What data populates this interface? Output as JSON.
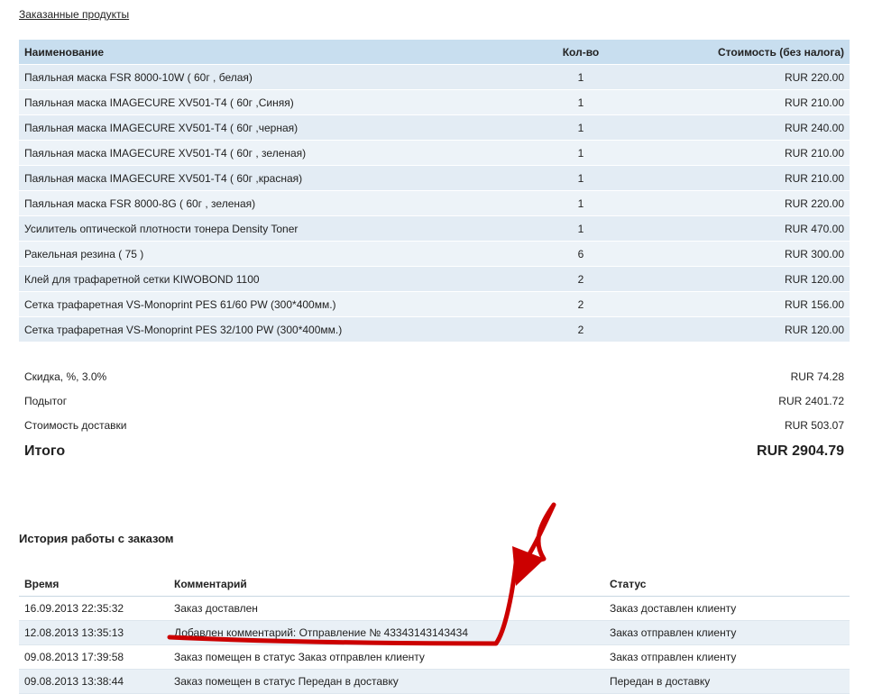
{
  "main": {
    "ordered_title": "Заказанные продукты",
    "columns": {
      "name": "Наименование",
      "qty": "Кол-во",
      "price": "Стоимость (без налога)"
    },
    "products": [
      {
        "name": "Паяльная маска FSR 8000-10W ( 60г , белая)",
        "qty": "1",
        "price": "RUR 220.00"
      },
      {
        "name": "Паяльная маска IMAGECURE XV501-T4 ( 60г ,Синяя)",
        "qty": "1",
        "price": "RUR 210.00"
      },
      {
        "name": "Паяльная маска IMAGECURE XV501-T4 ( 60г ,черная)",
        "qty": "1",
        "price": "RUR 240.00"
      },
      {
        "name": "Паяльная маска IMAGECURE XV501-T4 ( 60г , зеленая)",
        "qty": "1",
        "price": "RUR 210.00"
      },
      {
        "name": "Паяльная маска IMAGECURE XV501-T4 ( 60г ,красная)",
        "qty": "1",
        "price": "RUR 210.00"
      },
      {
        "name": "Паяльная маска FSR 8000-8G ( 60г , зеленая)",
        "qty": "1",
        "price": "RUR 220.00"
      },
      {
        "name": "Усилитель оптической плотности тонера Density Toner",
        "qty": "1",
        "price": "RUR 470.00"
      },
      {
        "name": "Ракельная резина ( 75 )",
        "qty": "6",
        "price": "RUR 300.00"
      },
      {
        "name": "Клей для трафаретной сетки KIWOBOND 1100",
        "qty": "2",
        "price": "RUR 120.00"
      },
      {
        "name": "Сетка трафаретная VS-Monoprint PES 61/60 PW (300*400мм.)",
        "qty": "2",
        "price": "RUR 156.00"
      },
      {
        "name": "Сетка трафаретная VS-Monoprint PES 32/100 PW (300*400мм.)",
        "qty": "2",
        "price": "RUR 120.00"
      }
    ],
    "totals": {
      "discount_label": "Скидка, %, 3.0%",
      "discount_value": "RUR 74.28",
      "subtotal_label": "Подытог",
      "subtotal_value": "RUR 2401.72",
      "shipping_label": "Стоимость доставки",
      "shipping_value": "RUR 503.07",
      "total_label": "Итого",
      "total_value": "RUR 2904.79"
    },
    "history_title": "История работы с заказом",
    "history_columns": {
      "time": "Время",
      "comment": "Комментарий",
      "status": "Статус"
    },
    "history": [
      {
        "time": "16.09.2013 22:35:32",
        "comment": "Заказ доставлен",
        "status": "Заказ доставлен клиенту"
      },
      {
        "time": "12.08.2013 13:35:13",
        "comment": "Добавлен комментарий: Отправление № 43343143143434",
        "status": "Заказ отправлен клиенту"
      },
      {
        "time": "09.08.2013 17:39:58",
        "comment": "Заказ помещен в статус Заказ отправлен клиенту",
        "status": "Заказ отправлен клиенту"
      },
      {
        "time": "09.08.2013 13:38:44",
        "comment": "Заказ помещен в статус Передан в доставку",
        "status": "Передан в доставку"
      }
    ]
  },
  "annotation": {
    "color": "#cc0000"
  }
}
